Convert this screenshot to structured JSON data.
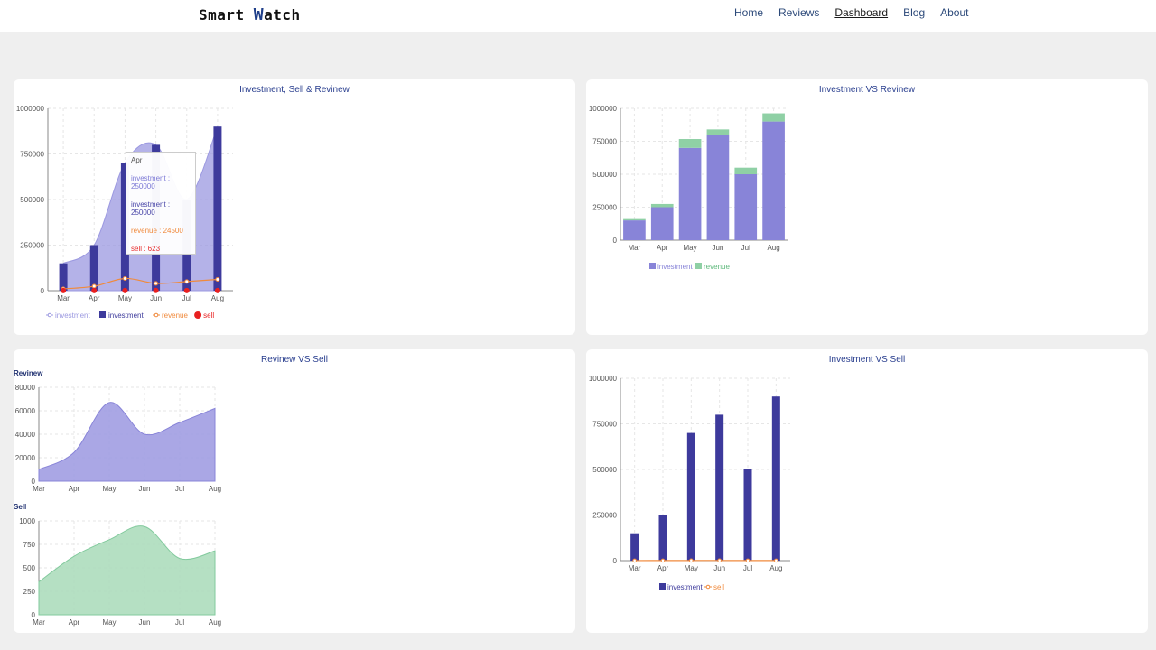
{
  "header": {
    "brand_prefix": "Smart ",
    "brand_w": "W",
    "brand_suffix": "atch",
    "nav": [
      "Home",
      "Reviews",
      "Dashboard",
      "Blog",
      "About"
    ],
    "active_nav": "Dashboard"
  },
  "colors": {
    "investment_area": "#9b98e0",
    "investment_bar": "#3d3a9c",
    "revenue": "#f08a3c",
    "sell": "#e82020",
    "revenue_bar": "#8fd0a5",
    "sell_area": "#a8dbb8"
  },
  "charts": {
    "c1": {
      "title": "Investment, Sell & Revinew"
    },
    "c2": {
      "title": "Investment VS Revinew"
    },
    "c3": {
      "title": "Revinew VS Sell",
      "top_label": "Revinew",
      "bottom_label": "Sell"
    },
    "c4": {
      "title": "Investment VS Sell"
    }
  },
  "tooltip": {
    "month": "Apr",
    "line1": "investment : 250000",
    "line2": "investment : 250000",
    "line3": "revenue : 24500",
    "line4": "sell : 623"
  },
  "chart_data": [
    {
      "type": "bar",
      "title": "Investment, Sell & Revinew",
      "categories": [
        "Mar",
        "Apr",
        "May",
        "Jun",
        "Jul",
        "Aug"
      ],
      "ylim": [
        0,
        1000000
      ],
      "yticks": [
        "0",
        "250000",
        "500000",
        "750000",
        "1000000"
      ],
      "series": [
        {
          "name": "investment",
          "kind": "area",
          "values": [
            150000,
            250000,
            700000,
            800000,
            500000,
            900000
          ]
        },
        {
          "name": "investment",
          "kind": "bar",
          "values": [
            150000,
            250000,
            700000,
            800000,
            500000,
            900000
          ]
        },
        {
          "name": "revenue",
          "kind": "line",
          "values": [
            10000,
            24500,
            67000,
            40000,
            50000,
            62000
          ]
        },
        {
          "name": "sell",
          "kind": "scatter",
          "values": [
            350,
            623,
            800,
            940,
            600,
            680
          ]
        }
      ],
      "legend": [
        "investment",
        "investment",
        "revenue",
        "sell"
      ]
    },
    {
      "type": "bar",
      "title": "Investment VS Revinew",
      "categories": [
        "Mar",
        "Apr",
        "May",
        "Jun",
        "Jul",
        "Aug"
      ],
      "ylim": [
        0,
        1000000
      ],
      "yticks": [
        "0",
        "250000",
        "500000",
        "750000",
        "1000000"
      ],
      "series": [
        {
          "name": "investment",
          "values": [
            150000,
            250000,
            700000,
            800000,
            500000,
            900000
          ]
        },
        {
          "name": "revenue",
          "values": [
            10000,
            24500,
            67000,
            40000,
            50000,
            62000
          ]
        }
      ],
      "legend": [
        "investment",
        "revenue"
      ]
    },
    {
      "type": "area",
      "title": "Revinew VS Sell",
      "categories": [
        "Mar",
        "Apr",
        "May",
        "Jun",
        "Jul",
        "Aug"
      ],
      "panels": [
        {
          "name": "Revinew",
          "ylim": [
            0,
            80000
          ],
          "yticks": [
            "0",
            "20000",
            "40000",
            "60000",
            "80000"
          ],
          "values": [
            10000,
            24500,
            67000,
            40000,
            50000,
            62000
          ]
        },
        {
          "name": "Sell",
          "ylim": [
            0,
            1000
          ],
          "yticks": [
            "0",
            "250",
            "500",
            "750",
            "1000"
          ],
          "values": [
            350,
            623,
            800,
            940,
            600,
            680
          ]
        }
      ]
    },
    {
      "type": "bar",
      "title": "Investment VS Sell",
      "categories": [
        "Mar",
        "Apr",
        "May",
        "Jun",
        "Jul",
        "Aug"
      ],
      "ylim": [
        0,
        1000000
      ],
      "yticks": [
        "0",
        "250000",
        "500000",
        "750000",
        "1000000"
      ],
      "series": [
        {
          "name": "investment",
          "kind": "bar",
          "values": [
            150000,
            250000,
            700000,
            800000,
            500000,
            900000
          ]
        },
        {
          "name": "sell",
          "kind": "line",
          "values": [
            350,
            623,
            800,
            940,
            600,
            680
          ]
        }
      ],
      "legend": [
        "investment",
        "sell"
      ]
    }
  ]
}
